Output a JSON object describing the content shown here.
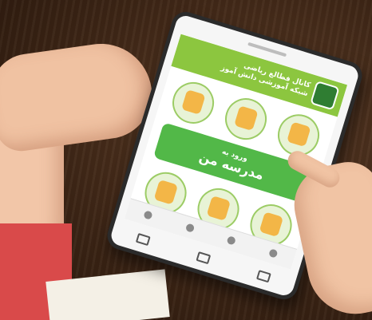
{
  "app": {
    "title_line1": "کانال فطالع ریاضی",
    "title_line2": "شبکه آموزشی دانش آموز"
  },
  "banner": {
    "line1": "ورود به",
    "line2": "مدرسه من"
  },
  "colors": {
    "header": "#8cc63f",
    "banner": "#52b848",
    "tablet_frame": "#2b2b2b",
    "table": "#3e2616"
  }
}
